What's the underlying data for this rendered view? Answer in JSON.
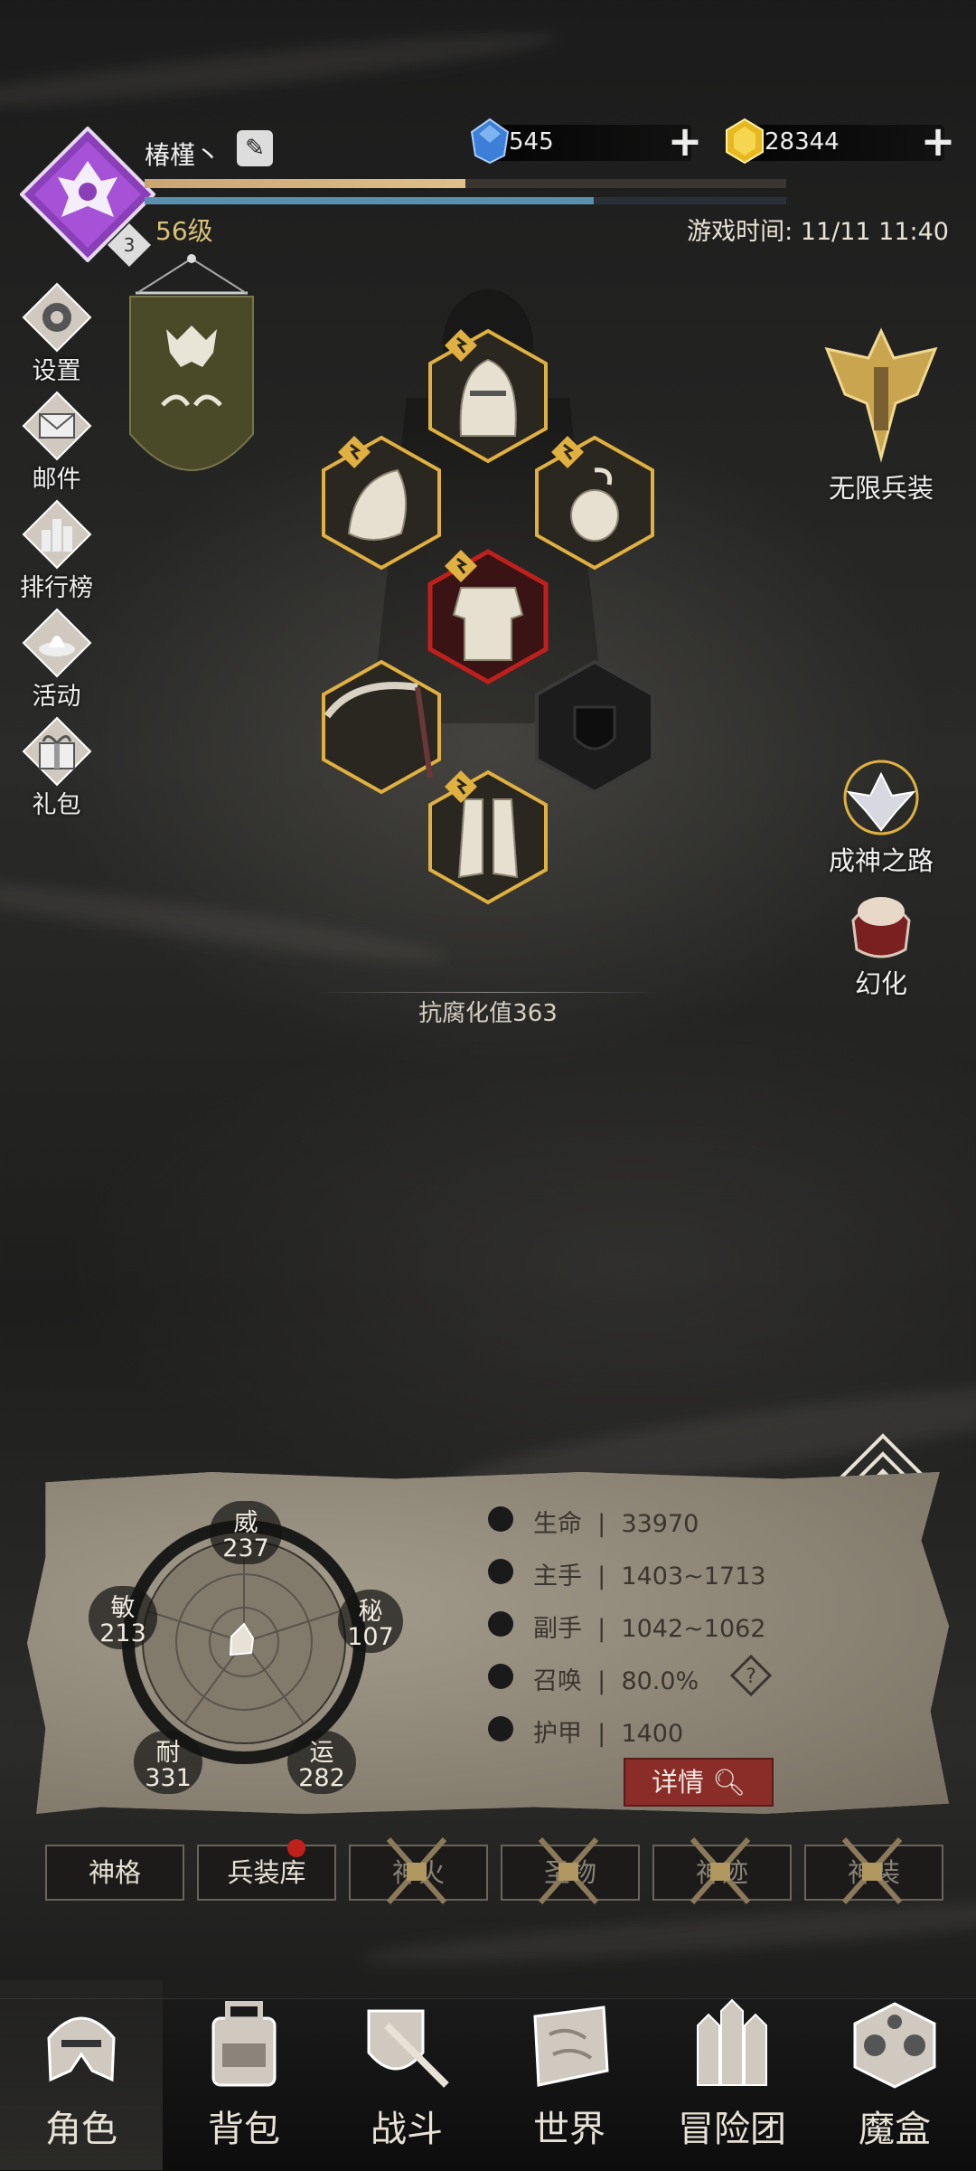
{
  "player": {
    "name": "椿槿丶",
    "level_text": "56级",
    "rank_badge": "3",
    "xp_fraction": 0.5,
    "hp_fraction": 0.7
  },
  "currency": {
    "gems": "545",
    "gold": "28344"
  },
  "game_time": "游戏时间: 11/11 11:40",
  "left_menu": [
    {
      "label": "设置",
      "icon": "gear-icon"
    },
    {
      "label": "邮件",
      "icon": "mail-icon"
    },
    {
      "label": "排行榜",
      "icon": "leaderboard-icon"
    },
    {
      "label": "活动",
      "icon": "event-icon"
    },
    {
      "label": "礼包",
      "icon": "gift-icon"
    }
  ],
  "right_menu": {
    "infinite": "无限兵装",
    "godpath": "成神之路",
    "transform": "幻化"
  },
  "corruption": "抗腐化值363",
  "attributes": {
    "wei": {
      "name": "威",
      "value": "237"
    },
    "mi": {
      "name": "秘",
      "value": "107"
    },
    "yun": {
      "name": "运",
      "value": "282"
    },
    "nai": {
      "name": "耐",
      "value": "331"
    },
    "min": {
      "name": "敏",
      "value": "213"
    }
  },
  "stats": [
    {
      "label": "生命",
      "value": "33970",
      "icon": "heart-icon"
    },
    {
      "label": "主手",
      "value": "1403~1713",
      "icon": "sword-icon"
    },
    {
      "label": "副手",
      "value": "1042~1062",
      "icon": "offhand-icon"
    },
    {
      "label": "召唤",
      "value": "80.0%",
      "icon": "summon-icon"
    },
    {
      "label": "护甲",
      "value": "1400",
      "icon": "shield-icon"
    }
  ],
  "details_label": "详情",
  "tabs": [
    "神格",
    "兵装库",
    "神火",
    "圣物",
    "神迹",
    "神装"
  ],
  "nav": [
    "角色",
    "背包",
    "战斗",
    "世界",
    "冒险团",
    "魔盒"
  ],
  "colors": {
    "accent_gold": "#e0b040",
    "danger_red": "#c0201c",
    "purple": "#9a4fc8",
    "gem_blue": "#3d7fd8"
  }
}
